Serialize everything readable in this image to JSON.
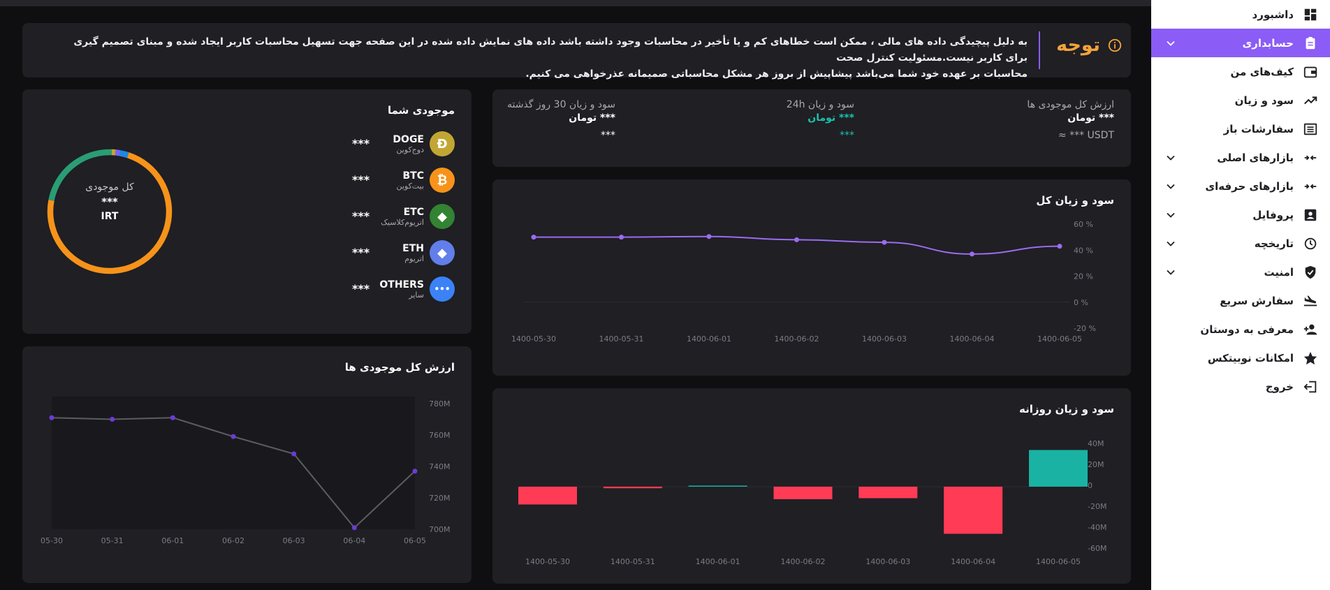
{
  "sidebar": {
    "items": [
      {
        "label": "داشبورد",
        "icon": "dashboard-icon"
      },
      {
        "label": "حسابداری",
        "icon": "clipboard-icon",
        "active": true,
        "expandable": true
      },
      {
        "label": "کیف‌های من",
        "icon": "wallet-icon"
      },
      {
        "label": "سود و زیان",
        "icon": "trending-up-icon"
      },
      {
        "label": "سفارشات باز",
        "icon": "list-icon"
      },
      {
        "label": "بازارهای اصلی",
        "icon": "exchange-icon",
        "expandable": true
      },
      {
        "label": "بازارهای حرفه‌ای",
        "icon": "exchange-icon",
        "expandable": true
      },
      {
        "label": "پروفایل",
        "icon": "profile-icon",
        "expandable": true
      },
      {
        "label": "تاریخچه",
        "icon": "history-icon",
        "expandable": true
      },
      {
        "label": "امنیت",
        "icon": "shield-icon",
        "expandable": true
      },
      {
        "label": "سفارش سریع",
        "icon": "flight-icon"
      },
      {
        "label": "معرفی به دوستان",
        "icon": "add-user-icon"
      },
      {
        "label": "امکانات نوبیتکس",
        "icon": "star-icon"
      },
      {
        "label": "خروج",
        "icon": "logout-icon"
      }
    ]
  },
  "notice": {
    "title": "توجه",
    "line1": "به دلیل پیچیدگی داده های مالی ، ممکن است خطاهای کم و یا تأخیر در محاسبات وجود داشته باشد داده های نمایش داده شده در این صفحه جهت تسهیل محاسبات کاربر ایجاد شده و مبنای تصمیم گیری برای کاربر نیست.مسئولیت کنترل صحت",
    "line2": "محاسبات بر عهده خود شما می‌باشد پیشاپیش از بروز هر مشکل محاسباتی صمیمانه عذرخواهی می کنیم."
  },
  "summary": {
    "total": {
      "label": "ارزش کل موجودی ها",
      "value": "*** تومان",
      "sub": "USDT *** ≈"
    },
    "pnl24": {
      "label": "سود و زیان 24h",
      "value": "*** تومان",
      "sub": "***"
    },
    "pnl30": {
      "label": "سود و زیان 30 روز گذشته",
      "value": "*** تومان",
      "sub": "***"
    }
  },
  "holdings": {
    "title": "موجودی شما",
    "center_label": "کل موجودی",
    "center_value": "***",
    "center_unit": "IRT",
    "coins": [
      {
        "symbol": "DOGE",
        "name": "دوج‌کوین",
        "amount": "***",
        "color": "#c2a633",
        "icon": "doge-icon",
        "glyph": "Ð"
      },
      {
        "symbol": "BTC",
        "name": "بیت‌کوین",
        "amount": "***",
        "color": "#f7931a",
        "icon": "bitcoin-icon",
        "glyph": "₿"
      },
      {
        "symbol": "ETC",
        "name": "اتریوم‌کلاسیک",
        "amount": "***",
        "color": "#328332",
        "icon": "ethereum-classic-icon",
        "glyph": "◆"
      },
      {
        "symbol": "ETH",
        "name": "اتریوم",
        "amount": "***",
        "color": "#627eea",
        "icon": "ethereum-icon",
        "glyph": "◆"
      },
      {
        "symbol": "OTHERS",
        "name": "سایر",
        "amount": "***",
        "color": "#3b82f6",
        "icon": "more-icon",
        "glyph": "•••"
      }
    ],
    "donut": [
      {
        "name": "BTC",
        "fraction": 0.73,
        "color": "#f7931a"
      },
      {
        "name": "ETC",
        "fraction": 0.225,
        "color": "#2a9d74"
      },
      {
        "name": "DOGE",
        "fraction": 0.01,
        "color": "#c2a633"
      },
      {
        "name": "ETH",
        "fraction": 0.012,
        "color": "#7b61ff"
      },
      {
        "name": "OTHERS",
        "fraction": 0.023,
        "color": "#1e88e5"
      }
    ]
  },
  "charts": {
    "pnl_total_title": "سود و زیان کل",
    "daily_title": "سود و زیان روزانه",
    "value_title": "ارزش کل موجودی ها"
  },
  "chart_data": [
    {
      "type": "line",
      "title": "سود و زیان کل",
      "x": [
        "1400-05-30",
        "1400-05-31",
        "1400-06-01",
        "1400-06-02",
        "1400-06-03",
        "1400-06-04",
        "1400-06-05"
      ],
      "y": [
        50,
        50,
        50.5,
        48,
        46,
        37,
        43
      ],
      "yticks": [
        "60 %",
        "40 %",
        "20 %",
        "0 %",
        "-20 %"
      ],
      "ylim": [
        -20,
        60
      ],
      "color": "#9b6cf0"
    },
    {
      "type": "bar",
      "title": "سود و زیان روزانه",
      "categories": [
        "1400-05-30",
        "1400-05-31",
        "1400-06-01",
        "1400-06-02",
        "1400-06-03",
        "1400-06-04",
        "1400-06-05"
      ],
      "values": [
        -17,
        -1.5,
        1,
        -12,
        -11,
        -45,
        35
      ],
      "yticks": [
        "40M",
        "20M",
        "0",
        "-20M",
        "-40M",
        "-60M"
      ],
      "ylim": [
        -60,
        40
      ],
      "pos_color": "#19b2a3",
      "neg_color": "#ff3b55"
    },
    {
      "type": "line",
      "title": "ارزش کل موجودی ها",
      "x": [
        "05-30",
        "05-31",
        "06-01",
        "06-02",
        "06-03",
        "06-04",
        "06-05"
      ],
      "y": [
        771,
        770,
        771,
        759,
        748,
        701,
        737
      ],
      "yticks": [
        "780M",
        "760M",
        "740M",
        "720M",
        "700M"
      ],
      "ylim": [
        700,
        780
      ],
      "color": "#5c5c63",
      "point_color": "#6a3cd6"
    }
  ]
}
